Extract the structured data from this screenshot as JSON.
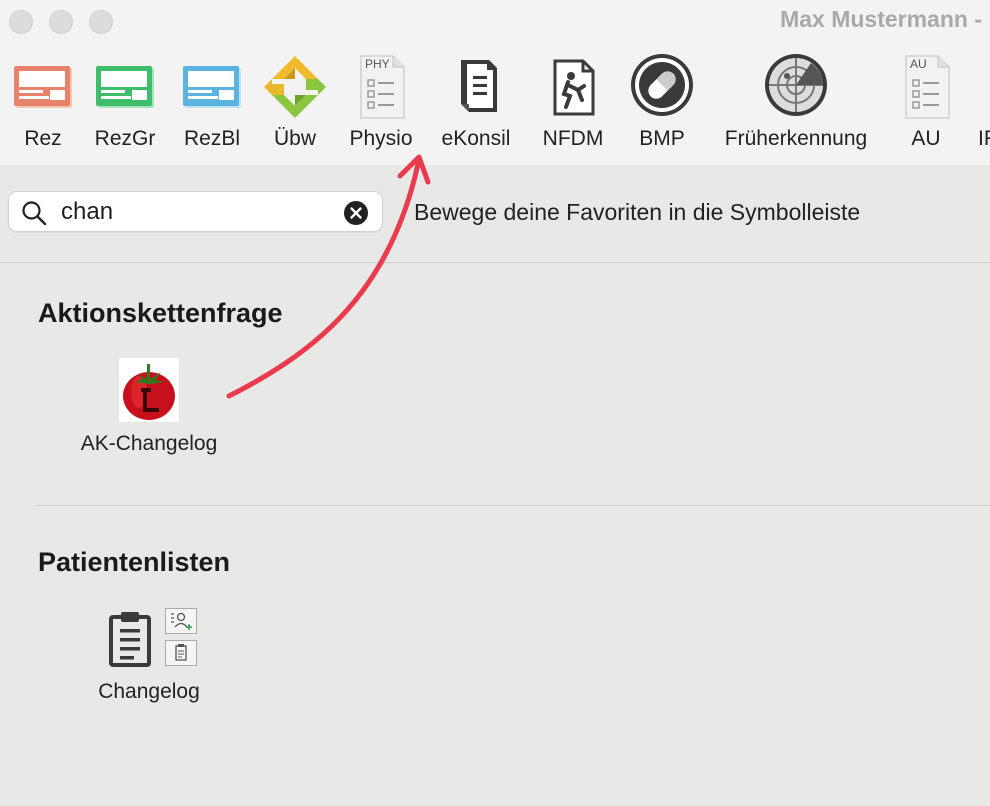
{
  "window": {
    "title": "Max Mustermann -"
  },
  "toolbar": {
    "items": [
      {
        "label": "Rez",
        "icon": "rezept-pink-icon",
        "color": "#e8826a"
      },
      {
        "label": "RezGr",
        "icon": "rezept-green-icon",
        "color": "#3ebd6a"
      },
      {
        "label": "RezBl",
        "icon": "rezept-blue-icon",
        "color": "#5bb3e0"
      },
      {
        "label": "Übw",
        "icon": "ueberweisung-icon"
      },
      {
        "label": "Physio",
        "icon": "physio-form-icon",
        "badge": "PHY"
      },
      {
        "label": "eKonsil",
        "icon": "ekonsil-document-icon"
      },
      {
        "label": "NFDM",
        "icon": "nfdm-emergency-icon"
      },
      {
        "label": "BMP",
        "icon": "bmp-pill-icon"
      },
      {
        "label": "Früherkennung",
        "icon": "radar-icon"
      },
      {
        "label": "AU",
        "icon": "au-form-icon",
        "badge": "AU"
      },
      {
        "label": "IF",
        "icon": "truncated-icon"
      }
    ]
  },
  "search": {
    "value": "chan",
    "placeholder": ""
  },
  "hint": "Bewege deine Favoriten in die Symbolleiste",
  "sections": [
    {
      "title": "Aktionskettenfrage",
      "items": [
        {
          "label": "AK-Changelog",
          "icon": "tomato-t-icon"
        }
      ]
    },
    {
      "title": "Patientenlisten",
      "items": [
        {
          "label": "Changelog",
          "icon": "clipboard-icon"
        }
      ]
    }
  ],
  "colors": {
    "arrow": "#ea3a4d",
    "background": "#e8e8e7",
    "toolbar_bg": "#f4f3f3"
  }
}
